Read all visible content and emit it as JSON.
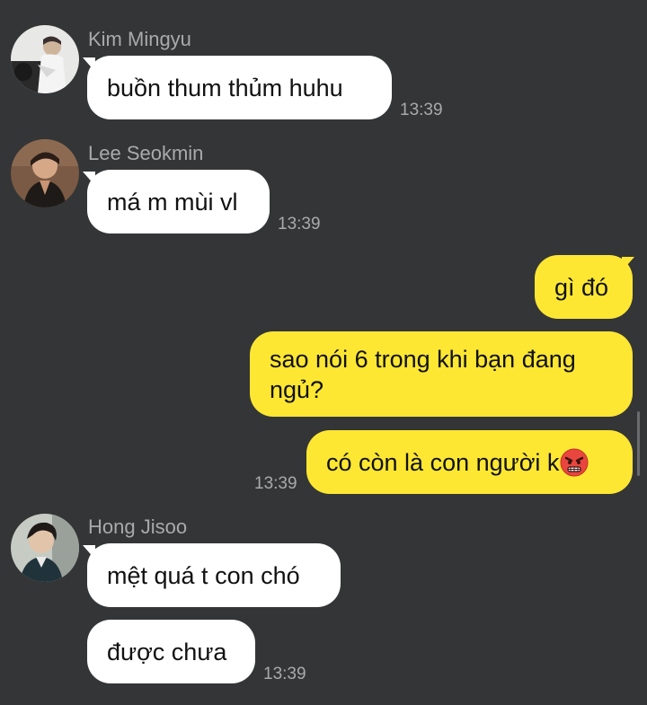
{
  "messages": [
    {
      "sender": "Kim Mingyu",
      "avatar_icon": "profile-photo-icon",
      "text": "buồn thum thủm huhu",
      "time": "13:39"
    },
    {
      "sender": "Lee Seokmin",
      "avatar_icon": "profile-photo-icon",
      "text": "má m mùi vl",
      "time": "13:39"
    },
    {
      "sender": "me",
      "texts": [
        "gì đó",
        "sao nói 6 trong khi bạn đang ngủ?",
        "có còn là con người k"
      ],
      "emoji": "angry-face-icon",
      "time": "13:39"
    },
    {
      "sender": "Hong Jisoo",
      "avatar_icon": "profile-photo-icon",
      "texts": [
        "mệt quá t con chó",
        "được chưa"
      ],
      "time": "13:39"
    }
  ],
  "colors": {
    "background": "#343536",
    "incoming_bubble": "#ffffff",
    "outgoing_bubble": "#fde733",
    "meta_text": "#a9aaab"
  }
}
